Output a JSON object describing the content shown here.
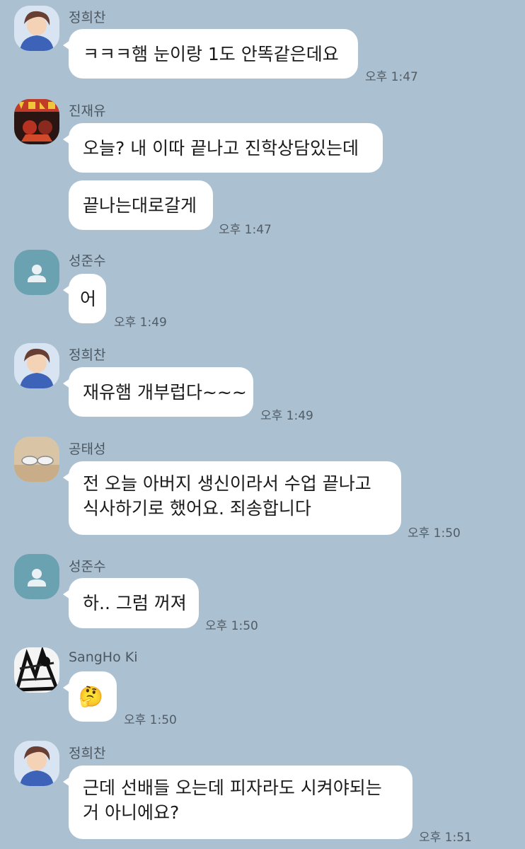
{
  "messages": [
    {
      "sender": "정희찬",
      "avatar": "anime-boy-avatar",
      "lines": [
        "ㅋㅋㅋ햄 눈이랑 1도 안똑같은데요"
      ],
      "time": "오후 1:47"
    },
    {
      "sender": "진재유",
      "avatar": "acdc-avatar",
      "lines": [
        "오늘? 내 이따 끝나고 진학상담있는데"
      ],
      "time": ""
    },
    {
      "sender": "",
      "avatar": "",
      "lines": [
        "끝나는대로갈게"
      ],
      "time": "오후 1:47"
    },
    {
      "sender": "성준수",
      "avatar": "default-person-avatar",
      "lines": [
        "어"
      ],
      "time": "오후 1:49"
    },
    {
      "sender": "정희찬",
      "avatar": "anime-boy-avatar",
      "lines": [
        "재유햄 개부럽다~~~"
      ],
      "time": "오후 1:49"
    },
    {
      "sender": "공태성",
      "avatar": "sneakers-avatar",
      "lines": [
        "전 오늘 아버지 생신이라서 수업 끝나고",
        "식사하기로 했어요. 죄송합니다"
      ],
      "time": "오후 1:50"
    },
    {
      "sender": "성준수",
      "avatar": "default-person-avatar",
      "lines": [
        "하.. 그럼 꺼져"
      ],
      "time": "오후 1:50"
    },
    {
      "sender": "SangHo Ki",
      "avatar": "manga-avatar",
      "lines": [
        "🤔"
      ],
      "time": "오후 1:50"
    },
    {
      "sender": "정희찬",
      "avatar": "anime-boy-avatar",
      "lines": [
        "근데 선배들 오는데 피자라도 시켜야되는",
        "거 아니에요?"
      ],
      "time": "오후 1:51"
    }
  ],
  "colors": {
    "background": "#abc1d1",
    "bubble": "#ffffff",
    "default_avatar": "#6aa2b2"
  }
}
